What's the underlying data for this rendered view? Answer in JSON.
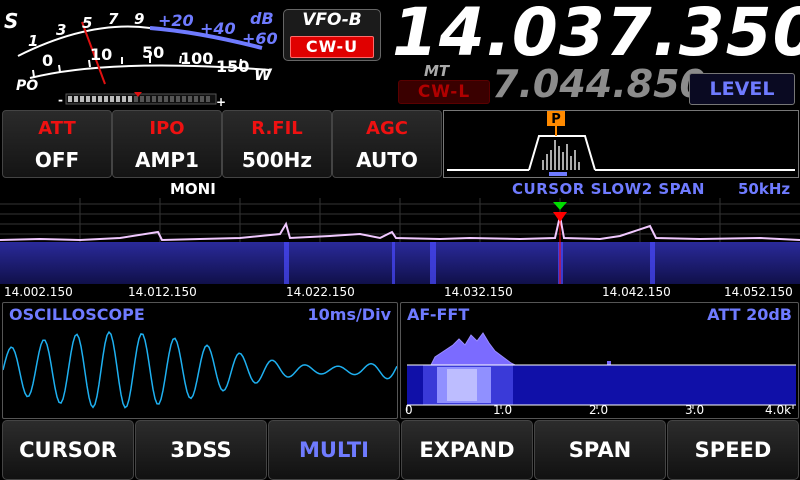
{
  "meter": {
    "s_label": "S",
    "s_ticks": [
      "1",
      "3",
      "5",
      "7",
      "9"
    ],
    "db_ticks": [
      "+20",
      "+40",
      "+60"
    ],
    "db_label": "dB",
    "po_label": "PO",
    "po_ticks": [
      "0",
      "10",
      "50",
      "100",
      "150"
    ],
    "w_label": "W",
    "minus": "-",
    "plus": "+",
    "colors": {
      "red": "#e01010",
      "blue": "#6f7bff"
    }
  },
  "vfo_b": {
    "label": "VFO-B",
    "mode": "CW-U"
  },
  "main_freq": "14.037.350",
  "sub": {
    "mt": "MT",
    "mode": "CW-L",
    "freq": "7.044.850"
  },
  "level_button": "LEVEL",
  "functions": [
    {
      "title": "ATT",
      "value": "OFF"
    },
    {
      "title": "IPO",
      "value": "AMP1"
    },
    {
      "title": "R.FIL",
      "value": "500Hz"
    },
    {
      "title": "AGC",
      "value": "AUTO"
    }
  ],
  "filter": {
    "marker": "P"
  },
  "spectrum": {
    "moni": "MONI",
    "cursor_info": "CURSOR SLOW2 SPAN",
    "span": "50kHz",
    "freq_labels": [
      "14.002.150",
      "14.012.150",
      "14.022.150",
      "14.032.150",
      "14.042.150",
      "14.052.150"
    ]
  },
  "oscilloscope": {
    "title": "OSCILLOSCOPE",
    "value": "10ms/Div"
  },
  "affft": {
    "title": "AF-FFT",
    "value": "ATT 20dB",
    "axis": [
      "0",
      "1.0",
      "2.0",
      "3.0",
      "4.0k"
    ]
  },
  "buttons": [
    "CURSOR",
    "3DSS",
    "MULTI",
    "EXPAND",
    "SPAN",
    "SPEED"
  ],
  "active_button": "MULTI"
}
